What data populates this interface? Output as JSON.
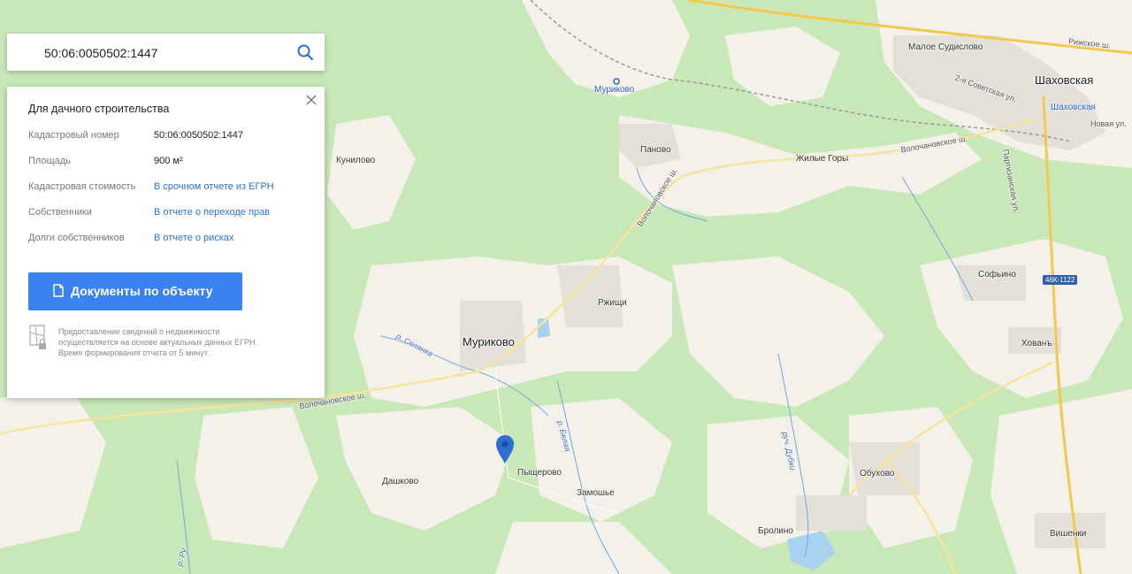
{
  "search": {
    "value": "50:06:0050502:1447"
  },
  "card": {
    "title": "Для дачного строительства",
    "rows": [
      {
        "key": "Кадастровый номер",
        "value": "50:06:0050502:1447",
        "is_link": false
      },
      {
        "key": "Площадь",
        "value": "900 м²",
        "is_link": false
      },
      {
        "key": "Кадастровая стоимость",
        "value": "В срочном отчете из ЕГРН",
        "is_link": true
      },
      {
        "key": "Собственники",
        "value": "В отчете о переходе прав",
        "is_link": true
      },
      {
        "key": "Долги собственников",
        "value": "В отчете о рисках",
        "is_link": true
      }
    ],
    "documents_button": "Документы по объекту",
    "note": "Предоставление сведений о недвижимости осуществляется на основе актуальных данных ЕГРН. Время формирования отчета от 5 минут."
  },
  "map": {
    "places": [
      {
        "name": "Малое Судислово",
        "kind": "village"
      },
      {
        "name": "Шаховская",
        "kind": "town"
      },
      {
        "name": "Шаховская",
        "kind": "station"
      },
      {
        "name": "Муриково",
        "kind": "station"
      },
      {
        "name": "Кунилово",
        "kind": "village"
      },
      {
        "name": "Паново",
        "kind": "village"
      },
      {
        "name": "Жилые Горы",
        "kind": "village"
      },
      {
        "name": "Ржищи",
        "kind": "village"
      },
      {
        "name": "Муриково",
        "kind": "village-big"
      },
      {
        "name": "Софьино",
        "kind": "village"
      },
      {
        "name": "Хованъ",
        "kind": "village"
      },
      {
        "name": "Обухово",
        "kind": "village"
      },
      {
        "name": "Дашково",
        "kind": "village"
      },
      {
        "name": "Пыщерово",
        "kind": "village"
      },
      {
        "name": "Замошье",
        "kind": "village"
      },
      {
        "name": "Бролино",
        "kind": "village"
      },
      {
        "name": "Вишенки",
        "kind": "village"
      },
      {
        "name": "Новая ул.",
        "kind": "street"
      }
    ],
    "roads": [
      {
        "name": "Рижское ш."
      },
      {
        "name": "2-я Советская ул."
      },
      {
        "name": "Волочановское ш."
      },
      {
        "name": "Волочановское ш."
      },
      {
        "name": "Волочановское ш."
      },
      {
        "name": "Партизанская ул."
      }
    ],
    "rivers": [
      {
        "name": "р. Селянка"
      },
      {
        "name": "р. Белая"
      },
      {
        "name": "руч. Дубки"
      },
      {
        "name": "р. Ру"
      }
    ],
    "road_badge": "46К-1122",
    "colors": {
      "forest": "#c3e6b3",
      "field": "#f4f1ea",
      "water": "#a9d2f0",
      "road": "#f6d66c",
      "marker": "#2a6fd1"
    }
  }
}
